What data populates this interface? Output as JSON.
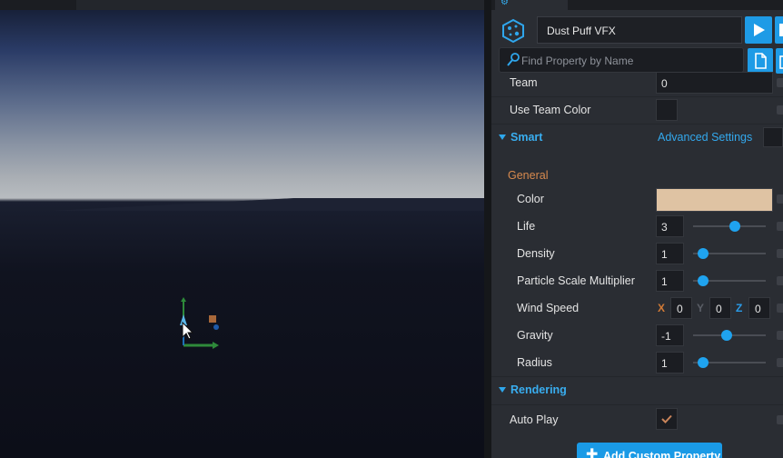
{
  "object": {
    "name": "Dust Puff VFX"
  },
  "search": {
    "placeholder": "Find Property by Name"
  },
  "top_properties": [
    {
      "label": "Team",
      "value": "0"
    },
    {
      "label": "Use Team Color",
      "checked": false
    }
  ],
  "smart": {
    "title": "Smart",
    "advanced_label": "Advanced Settings",
    "group_label": "General",
    "color": {
      "label": "Color",
      "value": "#dfc3a3"
    },
    "life": {
      "label": "Life",
      "value": "3",
      "slider_fraction": 0.57
    },
    "density": {
      "label": "Density",
      "value": "1",
      "slider_fraction": 0.14
    },
    "particle_scale": {
      "label": "Particle Scale Multiplier",
      "value": "1",
      "slider_fraction": 0.14
    },
    "wind_speed": {
      "label": "Wind Speed",
      "x_label": "X",
      "x": "0",
      "y_label": "Y",
      "y": "0",
      "z_label": "Z",
      "z": "0"
    },
    "gravity": {
      "label": "Gravity",
      "value": "-1",
      "slider_fraction": 0.46
    },
    "radius": {
      "label": "Radius",
      "value": "1",
      "slider_fraction": 0.14
    }
  },
  "rendering": {
    "title": "Rendering",
    "auto_play": {
      "label": "Auto Play",
      "checked": true
    }
  },
  "add_custom_property": "Add Custom Property",
  "colors": {
    "accent": "#1e9be6",
    "general_label": "#d88a4e",
    "axis_x": "#d27a36",
    "axis_y": "#5a5e66",
    "axis_z": "#2a9be8"
  }
}
